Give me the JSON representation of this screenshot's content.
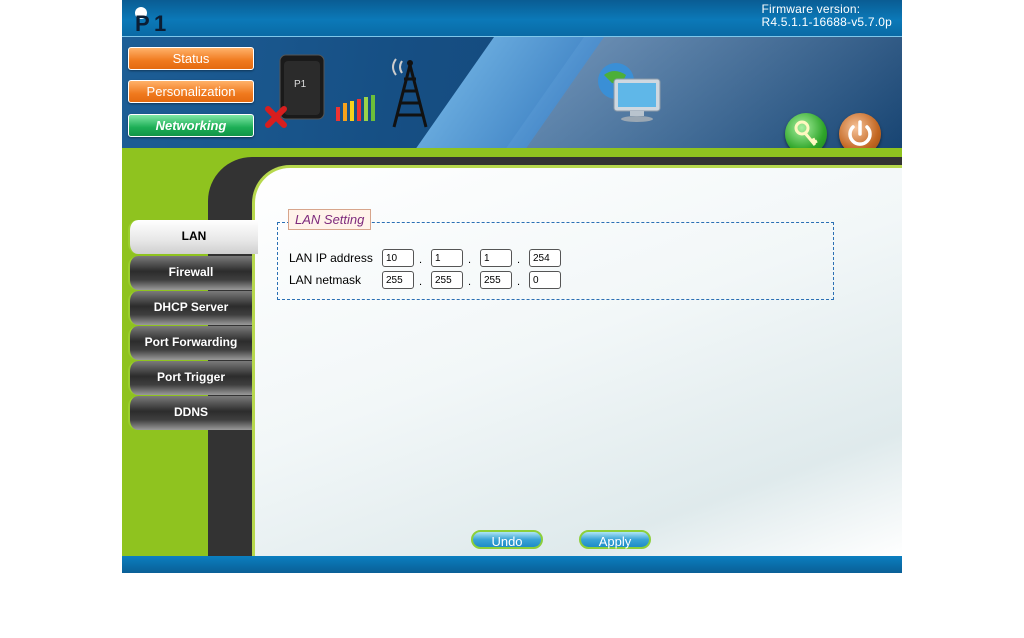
{
  "header": {
    "firmware_label": "Firmware version:",
    "firmware_version": "R4.5.1.1-16688-v5.7.0p"
  },
  "top_nav": {
    "status": "Status",
    "personalization": "Personalization",
    "networking": "Networking"
  },
  "sidebar": {
    "items": [
      {
        "label": "LAN",
        "active": true
      },
      {
        "label": "Firewall"
      },
      {
        "label": "DHCP Server"
      },
      {
        "label": "Port Forwarding"
      },
      {
        "label": "Port Trigger"
      },
      {
        "label": "DDNS"
      }
    ]
  },
  "lan_setting": {
    "legend": "LAN Setting",
    "ip_label": "LAN IP address",
    "ip": [
      "10",
      "1",
      "1",
      "254"
    ],
    "netmask_label": "LAN netmask",
    "netmask": [
      "255",
      "255",
      "255",
      "0"
    ]
  },
  "actions": {
    "undo": "Undo",
    "apply": "Apply"
  },
  "colors": {
    "accent_green": "#8fc31f",
    "header_blue": "#0b79b8",
    "nav_orange": "#f07a1e",
    "nav_green": "#1cae55"
  }
}
